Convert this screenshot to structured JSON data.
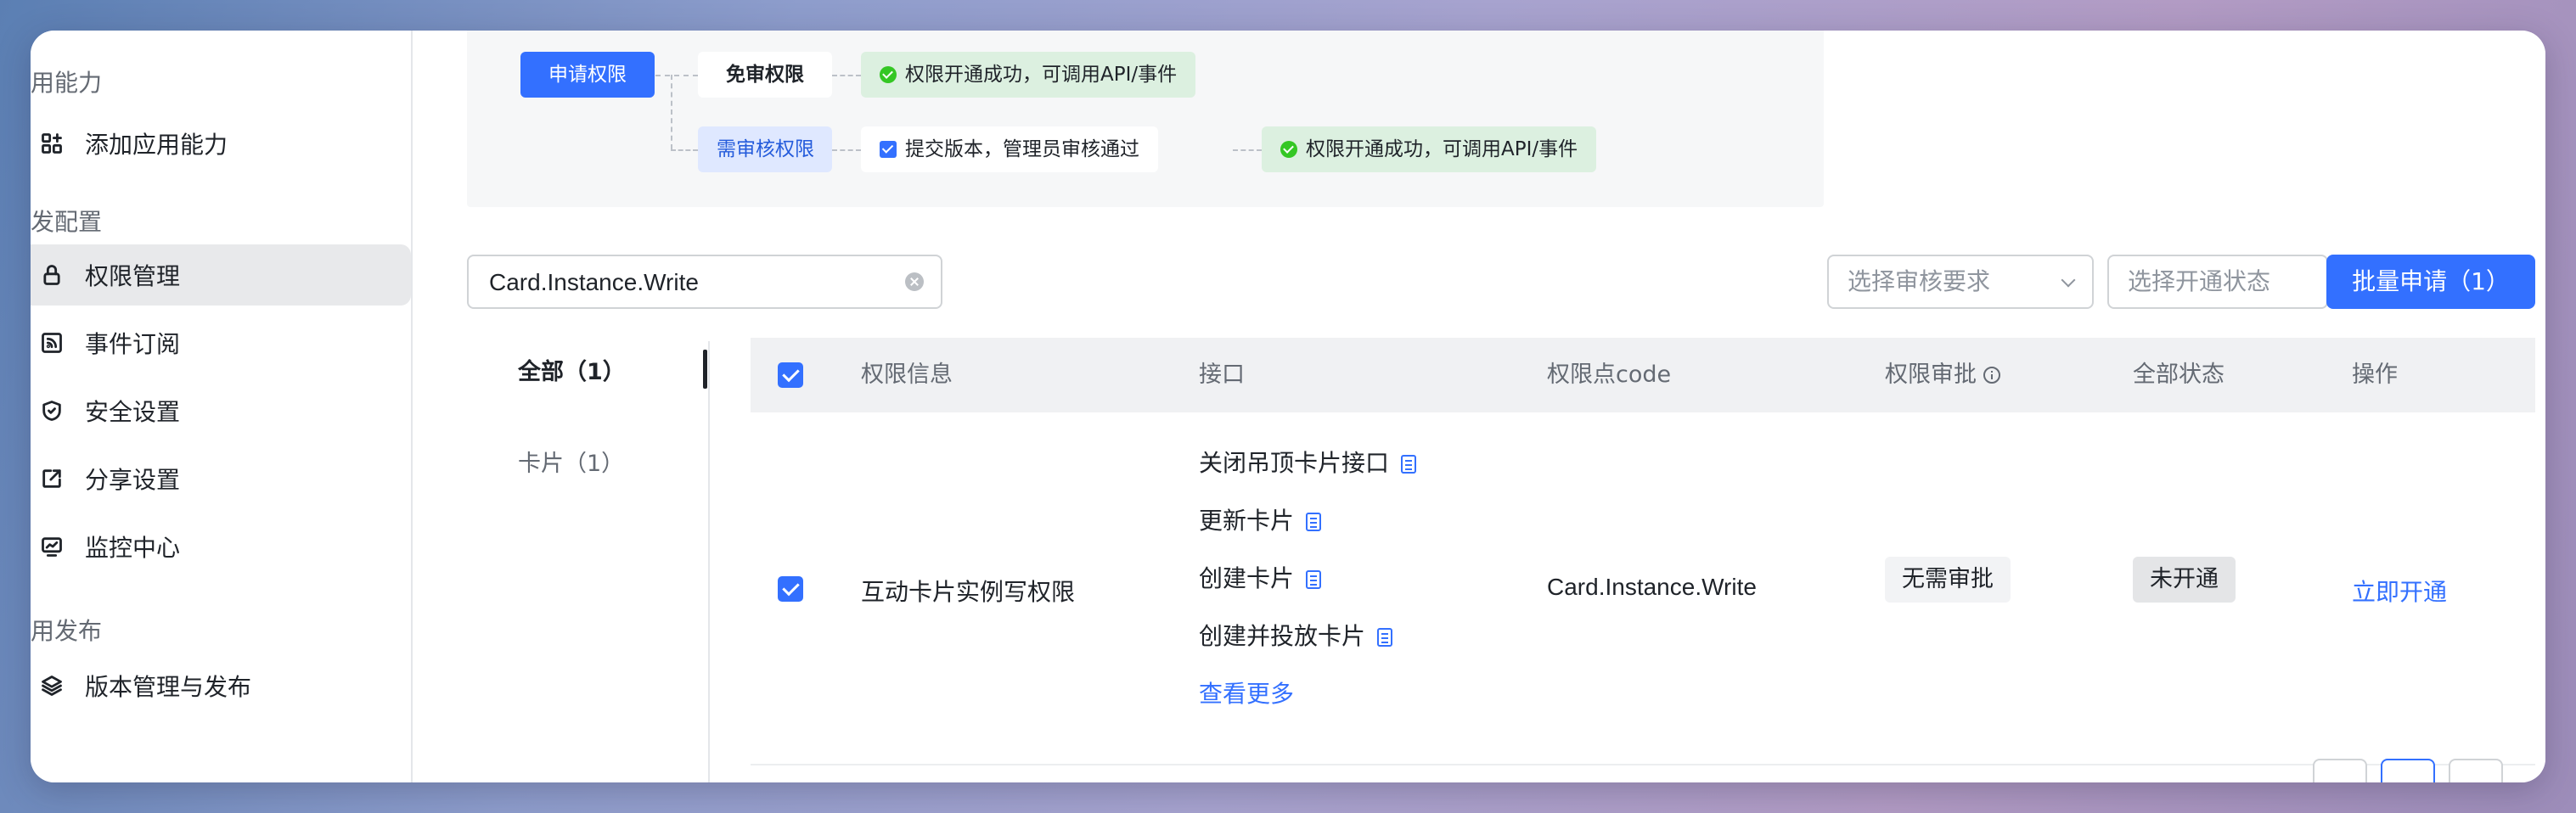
{
  "sidebar": {
    "groups": [
      "用能力",
      "发配置",
      "用发布"
    ],
    "items": [
      {
        "label": "添加应用能力",
        "icon": "app-grid-plus-icon"
      },
      {
        "label": "权限管理",
        "icon": "lock-icon"
      },
      {
        "label": "事件订阅",
        "icon": "rss-icon"
      },
      {
        "label": "安全设置",
        "icon": "shield-icon"
      },
      {
        "label": "分享设置",
        "icon": "share-external-icon"
      },
      {
        "label": "监控中心",
        "icon": "monitor-chart-icon"
      },
      {
        "label": "版本管理与发布",
        "icon": "layers-icon"
      }
    ],
    "active_item": "权限管理"
  },
  "flow": {
    "apply": "申请权限",
    "no_review": "免审权限",
    "need_review": "需审核权限",
    "submit": "提交版本，管理员审核通过",
    "success_1": "权限开通成功，可调用API/事件",
    "success_2": "权限开通成功，可调用API/事件"
  },
  "toolbar": {
    "search_value": "Card.Instance.Write",
    "review_select_placeholder": "选择审核要求",
    "status_select_placeholder": "选择开通状态",
    "batch_button": "批量申请（1）"
  },
  "categories": [
    {
      "label": "全部（1）",
      "active": true
    },
    {
      "label": "卡片（1）",
      "active": false
    }
  ],
  "table": {
    "headers": [
      "权限信息",
      "接口",
      "权限点code",
      "权限审批",
      "全部状态",
      "操作"
    ],
    "rows": [
      {
        "checked": true,
        "name": "互动卡片实例写权限",
        "apis": [
          "关闭吊顶卡片接口",
          "更新卡片",
          "创建卡片",
          "创建并投放卡片"
        ],
        "more": "查看更多",
        "code": "Card.Instance.Write",
        "approval": "无需审批",
        "status": "未开通",
        "action": "立即开通"
      }
    ]
  },
  "colors": {
    "primary": "#3370ff",
    "success_bg": "#dcf0e0",
    "success_icon": "#34c724",
    "sidebar_active_bg": "#e8e9eb"
  }
}
